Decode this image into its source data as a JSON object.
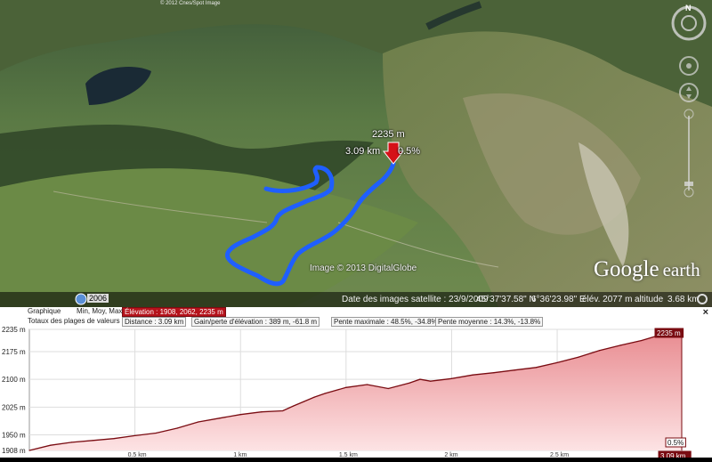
{
  "map": {
    "top_credit": "© 2012 Cnes/Spot Image",
    "imagery_credit": "Image © 2013 DigitalGlobe",
    "logo_google": "Google",
    "logo_earth": "earth",
    "marker": {
      "elevation": "2235 m",
      "distance": "3.09 km",
      "slope": "0.5%"
    },
    "status": {
      "imagery_date": "Date des images satellite : 23/9/2009",
      "lat": "45°37'37.58\" N",
      "lon": "6°36'23.98\" E",
      "elev": "élév. 2077 m",
      "altitude_label": "altitude",
      "altitude_value": "3.68 km"
    },
    "nav_north": "N"
  },
  "profile": {
    "graph_label": "Graphique",
    "min_label": "Min, Moy, Max",
    "elevation_cell": "Élévation : 1908, 2062, 2235 m",
    "totals_label": "Totaux des plages de valeurs",
    "distance_cell": "Distance : 3.09 km",
    "gain_cell": "Gain/perte d'élévation : 389 m, -61.8 m",
    "max_slope_cell": "Pente maximale : 48.5%, -34.8%",
    "avg_slope_cell": "Pente moyenne : 14.3%, -13.8%",
    "close": "×",
    "end_elev_flag": "2235 m",
    "end_slope_flag": "0.5%",
    "end_dist_flag": "3.09 km"
  },
  "chart_data": {
    "type": "area",
    "ylabel": "",
    "xlabel": "",
    "y_ticks": [
      "2235 m",
      "2175 m",
      "2100 m",
      "2025 m",
      "1950 m",
      "1908 m"
    ],
    "x_ticks": [
      "0.5 km",
      "1 km",
      "1.5 km",
      "2 km",
      "2.5 km",
      "3.09 km"
    ],
    "ylim": [
      1908,
      2235
    ],
    "xlim": [
      0,
      3.09
    ],
    "x": [
      0,
      0.1,
      0.2,
      0.3,
      0.4,
      0.5,
      0.6,
      0.7,
      0.8,
      0.9,
      1.0,
      1.1,
      1.2,
      1.25,
      1.3,
      1.35,
      1.4,
      1.5,
      1.6,
      1.7,
      1.8,
      1.85,
      1.9,
      2.0,
      2.1,
      2.2,
      2.3,
      2.4,
      2.5,
      2.6,
      2.7,
      2.8,
      2.9,
      3.0,
      3.09
    ],
    "y": [
      1908,
      1922,
      1930,
      1935,
      1940,
      1948,
      1955,
      1968,
      1985,
      1995,
      2005,
      2012,
      2015,
      2028,
      2040,
      2052,
      2062,
      2078,
      2086,
      2075,
      2090,
      2100,
      2095,
      2102,
      2112,
      2118,
      2125,
      2132,
      2145,
      2160,
      2178,
      2192,
      2205,
      2222,
      2235
    ]
  }
}
